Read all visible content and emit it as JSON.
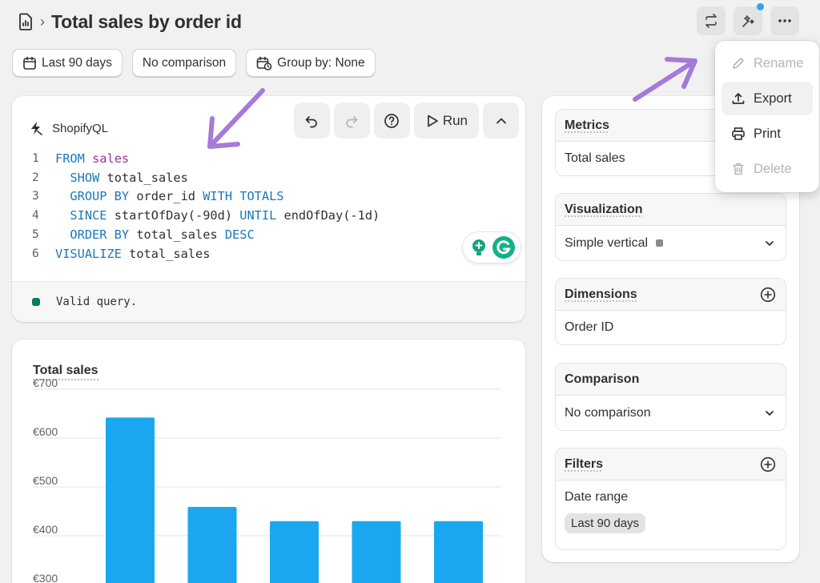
{
  "header": {
    "title": "Total sales by order id",
    "separator": "›"
  },
  "chips": [
    {
      "label": "Last 90 days",
      "icon": "calendar-icon"
    },
    {
      "label": "No comparison",
      "icon": ""
    },
    {
      "label": "Group by: None",
      "icon": "calendar-clock-icon"
    }
  ],
  "editor": {
    "title": "ShopifyQL",
    "run_label": "Run",
    "status": "Valid query.",
    "status_color": "#0d7a5f",
    "lines": [
      {
        "n": "1",
        "indent": "",
        "parts": [
          {
            "t": "FROM ",
            "c": "kw"
          },
          {
            "t": "sales",
            "c": "tb"
          }
        ]
      },
      {
        "n": "2",
        "indent": "  ",
        "parts": [
          {
            "t": "SHOW ",
            "c": "kw"
          },
          {
            "t": "total_sales",
            "c": "tx"
          }
        ]
      },
      {
        "n": "3",
        "indent": "  ",
        "parts": [
          {
            "t": "GROUP BY ",
            "c": "kw"
          },
          {
            "t": "order_id ",
            "c": "tx"
          },
          {
            "t": "WITH TOTALS",
            "c": "kw"
          }
        ]
      },
      {
        "n": "4",
        "indent": "  ",
        "parts": [
          {
            "t": "SINCE ",
            "c": "kw"
          },
          {
            "t": "startOfDay(-90d) ",
            "c": "tx"
          },
          {
            "t": "UNTIL ",
            "c": "kw"
          },
          {
            "t": "endOfDay(-1d)",
            "c": "tx"
          }
        ]
      },
      {
        "n": "5",
        "indent": "  ",
        "parts": [
          {
            "t": "ORDER BY ",
            "c": "kw"
          },
          {
            "t": "total_sales ",
            "c": "tx"
          },
          {
            "t": "DESC",
            "c": "kw"
          }
        ]
      },
      {
        "n": "6",
        "indent": "",
        "parts": [
          {
            "t": "VISUALIZE ",
            "c": "kw"
          },
          {
            "t": "total_sales",
            "c": "tx"
          }
        ]
      }
    ]
  },
  "chart_data": {
    "type": "bar",
    "title": "Total sales",
    "y_ticks": [
      "€700",
      "€600",
      "€500",
      "€400",
      "€300"
    ],
    "ylim": [
      300,
      700
    ],
    "values": [
      642,
      459,
      430,
      430,
      430
    ],
    "bar_color": "#1ba7f0",
    "grid": true
  },
  "panel": {
    "metrics": {
      "title": "Metrics",
      "value": "Total sales"
    },
    "visualization": {
      "title": "Visualization",
      "value": "Simple vertical"
    },
    "dimensions": {
      "title": "Dimensions",
      "value": "Order ID"
    },
    "comparison": {
      "title": "Comparison",
      "value": "No comparison"
    },
    "filters": {
      "title": "Filters",
      "label": "Date range",
      "badge": "Last 90 days"
    }
  },
  "menu": {
    "items": [
      {
        "label": "Rename",
        "icon": "pencil-icon",
        "state": "disabled"
      },
      {
        "label": "Export",
        "icon": "upload-icon",
        "state": "active"
      },
      {
        "label": "Print",
        "icon": "printer-icon",
        "state": "normal"
      },
      {
        "label": "Delete",
        "icon": "trash-icon",
        "state": "disabled"
      }
    ]
  },
  "colors": {
    "accent_arrow": "#a57ad8",
    "notification_dot": "#2ea3f2"
  }
}
